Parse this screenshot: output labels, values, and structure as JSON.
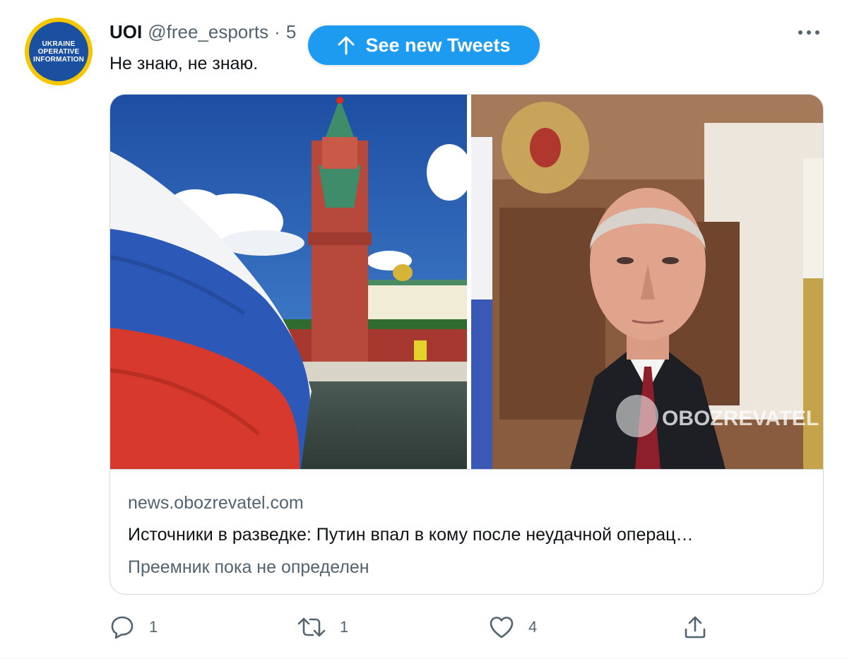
{
  "author": {
    "avatar_lines": [
      "UKRAINE",
      "OPERATIVE",
      "INFORMATION"
    ],
    "display_name": "UOI",
    "handle": "@free_esports",
    "separator": "·",
    "time": "5"
  },
  "new_tweets_button": {
    "label": "See new Tweets"
  },
  "tweet": {
    "text": "Не знаю, не знаю."
  },
  "card": {
    "domain": "news.obozrevatel.com",
    "title": "Источники в разведке: Путин впал в кому после неудачной операц…",
    "description": "Преемник пока не определен",
    "watermark": "OBOZREVATEL"
  },
  "actions": {
    "reply_count": "1",
    "retweet_count": "1",
    "like_count": "4",
    "share_label": ""
  },
  "colors": {
    "accent": "#1d9bf0",
    "text_primary": "#0f1419",
    "text_secondary": "#536471",
    "border": "#cfd9de"
  },
  "icons": [
    "more-icon",
    "arrow-up-icon",
    "reply-icon",
    "retweet-icon",
    "like-icon",
    "share-icon"
  ]
}
